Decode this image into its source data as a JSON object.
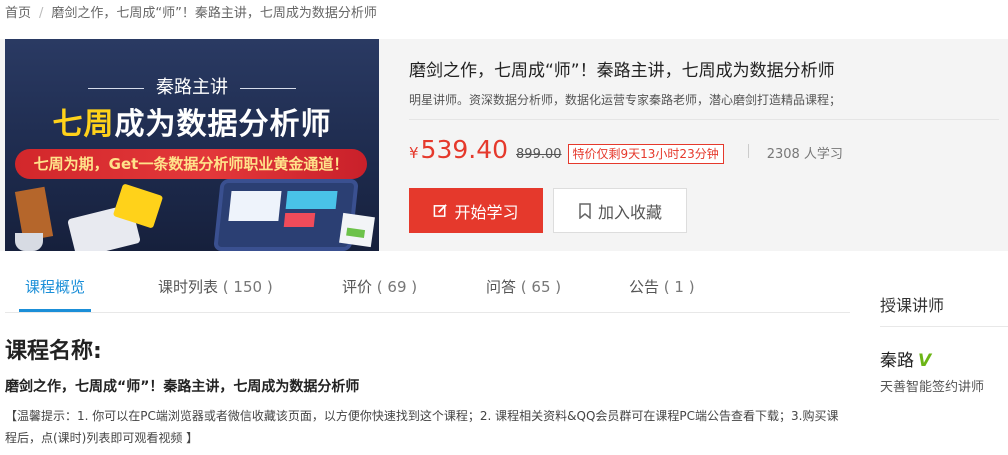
{
  "breadcrumb": {
    "home": "首页",
    "separator": "/",
    "current": "磨剑之作，七周成“师”！秦路主讲，七周成为数据分析师"
  },
  "banner": {
    "lecturer_line": "秦路主讲",
    "headline_highlight": "七周",
    "headline_rest": "成为数据分析师",
    "slogan": "七周为期，Get一条数据分析师职业黄金通道！"
  },
  "course": {
    "title": "磨剑之作，七周成“师”！秦路主讲，七周成为数据分析师",
    "description": "明星讲师。资深数据分析师，数据化运营专家秦路老师，潜心磨剑打造精品课程；",
    "currency": "¥",
    "price": "539.40",
    "original_price": "899.00",
    "promo": "特价仅剩9天13小时23分钟",
    "learners": "2308 人学习",
    "start_button": "开始学习",
    "favorite_button": "加入收藏"
  },
  "tabs": [
    {
      "label": "课程概览",
      "count": ""
    },
    {
      "label": "课时列表",
      "count": "( 150 )"
    },
    {
      "label": "评价",
      "count": "( 69 )"
    },
    {
      "label": "问答",
      "count": "( 65 )"
    },
    {
      "label": "公告",
      "count": "( 1 )"
    }
  ],
  "overview": {
    "heading": "课程名称:",
    "course_name": "磨剑之作，七周成“师”！秦路主讲，七周成为数据分析师",
    "tip": "【温馨提示：1. 你可以在PC端浏览器或者微信收藏该页面，以方便你快速找到这个课程；2. 课程相关资料&QQ会员群可在课程PC端公告查看下载；3.购买课程后，点(课时)列表即可观看视频 】"
  },
  "sidebar": {
    "heading": "授课讲师",
    "teacher_name": "秦路",
    "verified_badge": "V",
    "teacher_role": "天善智能签约讲师"
  },
  "colors": {
    "accent_red": "#e5392c",
    "tab_blue": "#1b8fd8",
    "verified_green": "#6cb516",
    "banner_navy": "#1d2a4c"
  },
  "icons": {
    "start": "edit-icon",
    "favorite": "bookmark-icon"
  }
}
